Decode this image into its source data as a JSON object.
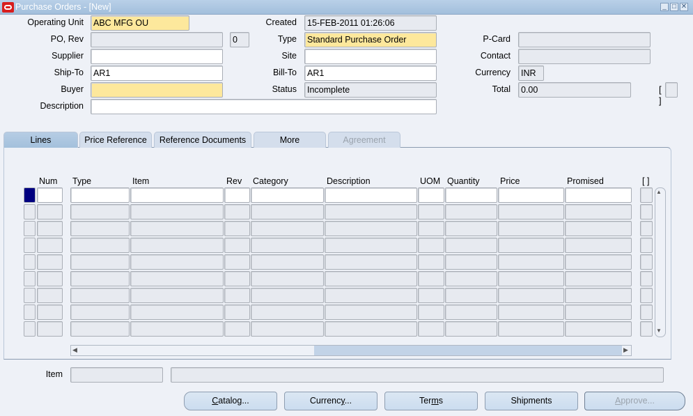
{
  "window": {
    "title": "Purchase Orders - [New]",
    "controls": [
      "minimize",
      "maximize",
      "close"
    ]
  },
  "header": {
    "operating_unit": {
      "label": "Operating Unit",
      "value": "ABC MFG OU"
    },
    "po": {
      "label": "PO, Rev",
      "value": "",
      "rev": "0"
    },
    "supplier": {
      "label": "Supplier",
      "value": ""
    },
    "ship_to": {
      "label": "Ship-To",
      "value": "AR1"
    },
    "buyer": {
      "label": "Buyer",
      "value": ""
    },
    "description": {
      "label": "Description",
      "value": ""
    },
    "created": {
      "label": "Created",
      "value": "15-FEB-2011 01:26:06"
    },
    "type": {
      "label": "Type",
      "value": "Standard Purchase Order"
    },
    "site": {
      "label": "Site",
      "value": ""
    },
    "bill_to": {
      "label": "Bill-To",
      "value": "AR1"
    },
    "status": {
      "label": "Status",
      "value": "Incomplete"
    },
    "pcard": {
      "label": "P-Card",
      "value": ""
    },
    "contact": {
      "label": "Contact",
      "value": ""
    },
    "currency": {
      "label": "Currency",
      "value": "INR"
    },
    "total": {
      "label": "Total",
      "value": "0.00"
    },
    "flex_bracket": "[ ]"
  },
  "tabs": [
    {
      "label": "Lines",
      "active": true
    },
    {
      "label": "Price Reference"
    },
    {
      "label": "Reference Documents"
    },
    {
      "label": "More"
    },
    {
      "label": "Agreement",
      "disabled": true
    }
  ],
  "lines": {
    "columns": [
      "Num",
      "Type",
      "Item",
      "Rev",
      "Category",
      "Description",
      "UOM",
      "Quantity",
      "Price",
      "Promised",
      "[ ]"
    ],
    "row_count": 9
  },
  "footer": {
    "item_label": "Item",
    "item_value": "",
    "item_desc": ""
  },
  "buttons": [
    {
      "pre": "",
      "u": "C",
      "post": "atalog..."
    },
    {
      "pre": "Currenc",
      "u": "y",
      "post": "..."
    },
    {
      "pre": "Ter",
      "u": "m",
      "post": "s"
    },
    {
      "pre": "Shipments",
      "u": "",
      "post": ""
    },
    {
      "pre": "",
      "u": "A",
      "post": "pprove...",
      "disabled": true
    }
  ],
  "colors": {
    "title_bar": "#a2bfdc",
    "required_field": "#fde89c",
    "current_record": "#000080"
  }
}
